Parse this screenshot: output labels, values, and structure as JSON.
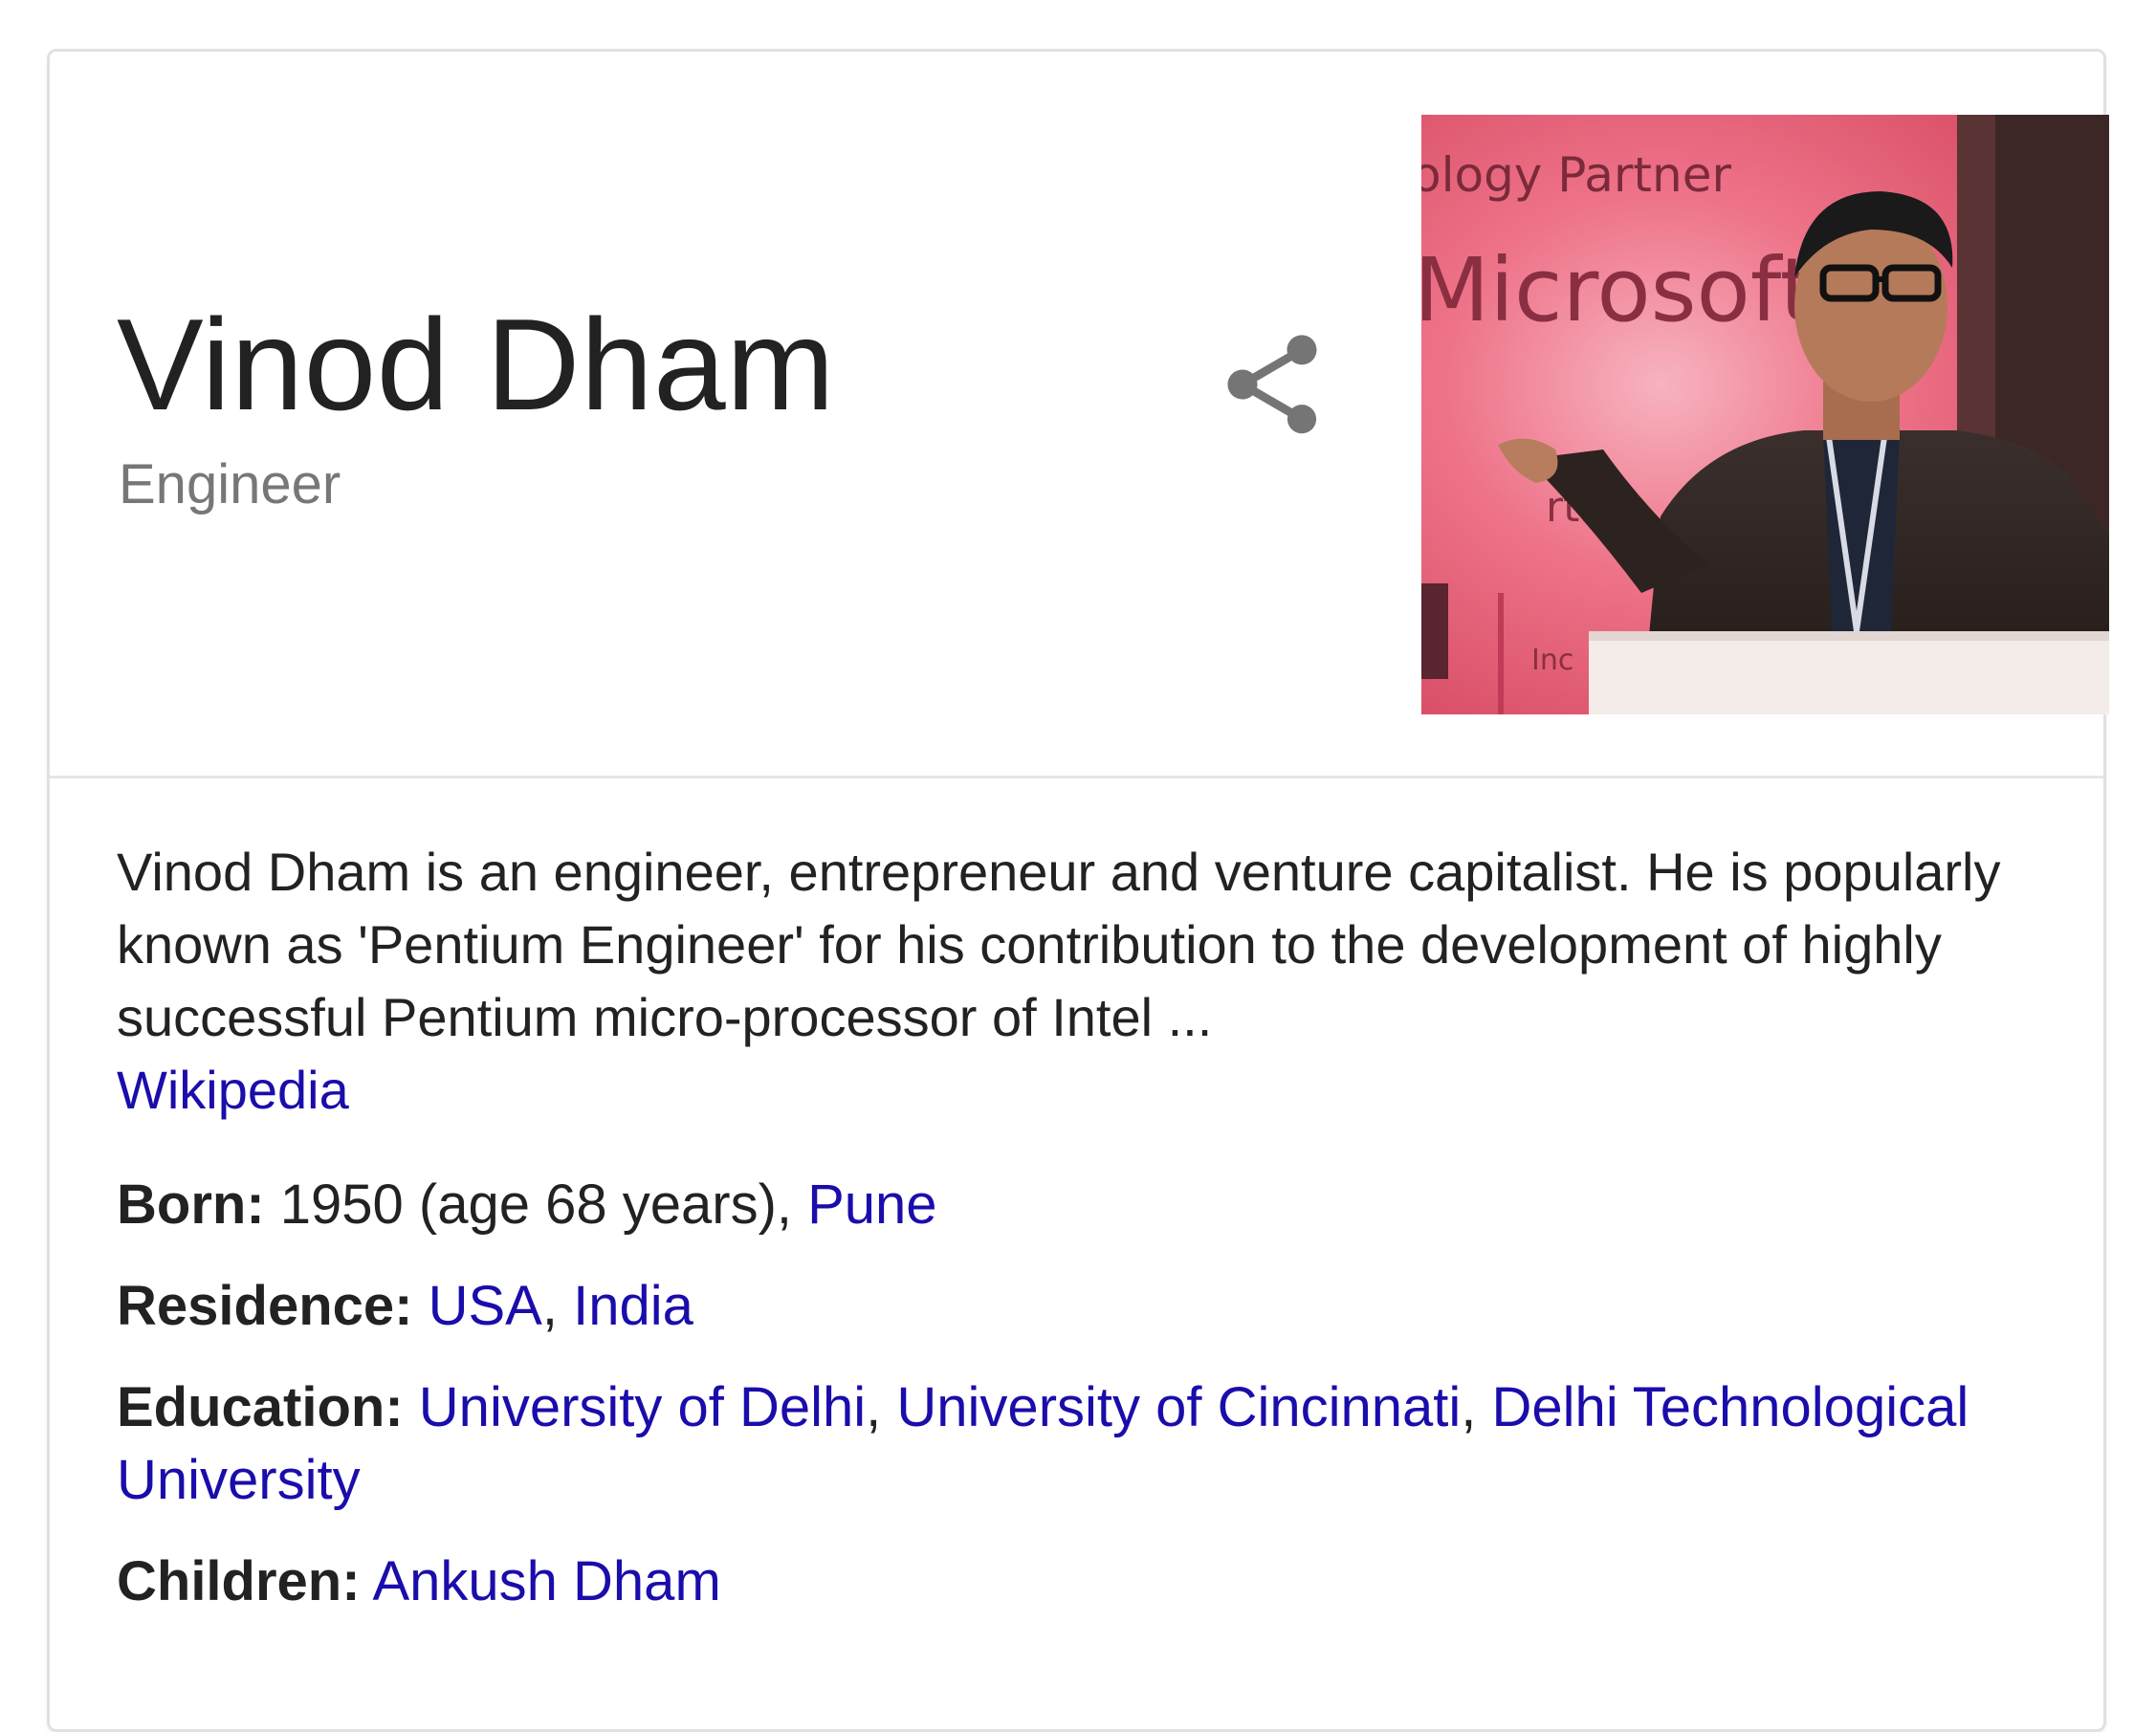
{
  "entity": {
    "title": "Vinod Dham",
    "subtitle": "Engineer"
  },
  "photo": {
    "banner_line1": "ology Partner",
    "banner_line2": "Microsoft",
    "banner_line3": "rtne",
    "banner_line4": "Inc"
  },
  "description": {
    "text": "Vinod Dham is an engineer, entrepreneur and venture capitalist. He is popularly known as 'Pentium Engineer' for his contribution to the development of highly successful Pentium micro-processor of Intel ...",
    "source_link": "Wikipedia"
  },
  "facts": {
    "born": {
      "label": "Born:",
      "text": "1950 (age 68 years), ",
      "link": "Pune"
    },
    "residence": {
      "label": "Residence:",
      "links": [
        "USA",
        "India"
      ],
      "separator": ", "
    },
    "education": {
      "label": "Education:",
      "links": [
        "University of Delhi",
        "University of Cincinnati",
        "Delhi Technological University"
      ],
      "separator": ", "
    },
    "children": {
      "label": "Children:",
      "link": "Ankush Dham"
    }
  },
  "colors": {
    "link": "#1a0dab",
    "text": "#222222",
    "muted": "#777777",
    "share_icon": "#757575"
  },
  "icons": {
    "share": "share-icon"
  }
}
